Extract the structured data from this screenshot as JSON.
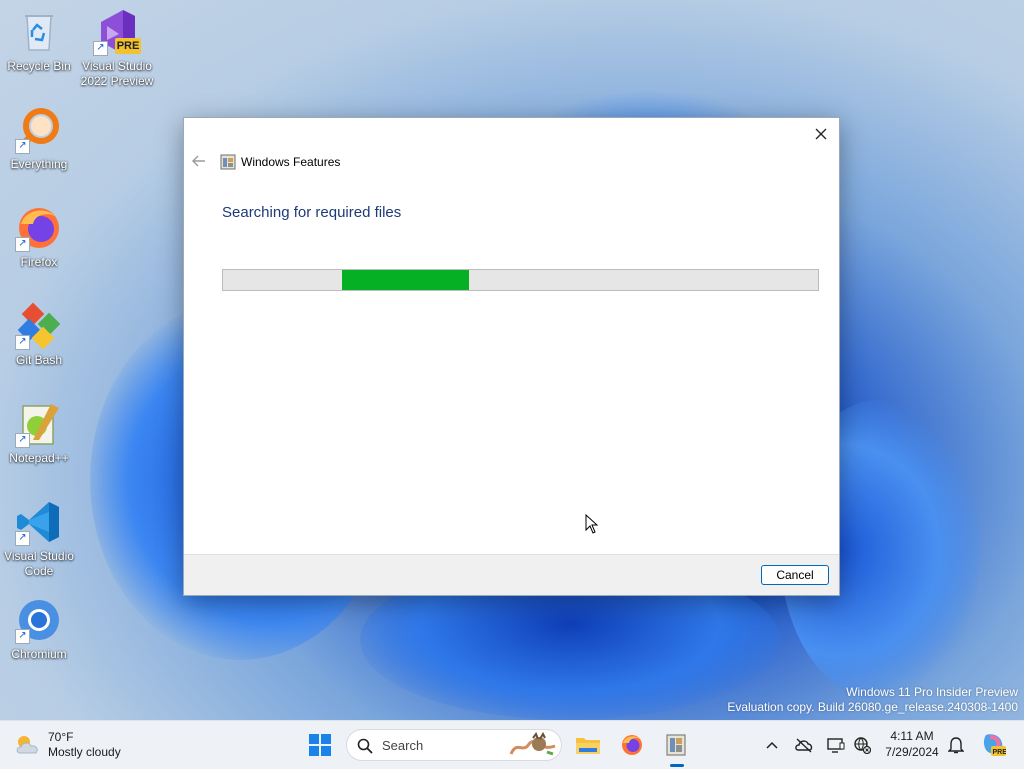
{
  "desktop": {
    "icons": [
      {
        "label": "Recycle Bin"
      },
      {
        "label": "Visual Studio 2022 Preview",
        "badge": "PRE"
      },
      {
        "label": "Everything"
      },
      {
        "label": "Firefox"
      },
      {
        "label": "Git Bash"
      },
      {
        "label": "Notepad++"
      },
      {
        "label": "Visual Studio Code"
      },
      {
        "label": "Chromium"
      }
    ],
    "watermark": {
      "line1": "Windows 11 Pro Insider Preview",
      "line2": "Evaluation copy. Build 26080.ge_release.240308-1400"
    }
  },
  "dialog": {
    "title": "Windows Features",
    "heading": "Searching for required files",
    "progress": {
      "start_fraction": 0.2,
      "end_fraction": 0.413,
      "color": "#06b025"
    },
    "cancel_label": "Cancel"
  },
  "taskbar": {
    "weather": {
      "temp": "70°F",
      "condition": "Mostly cloudy"
    },
    "search_label": "Search",
    "clock": {
      "time": "4:11 AM",
      "date": "7/29/2024"
    },
    "accent_color": "#0067c0"
  }
}
